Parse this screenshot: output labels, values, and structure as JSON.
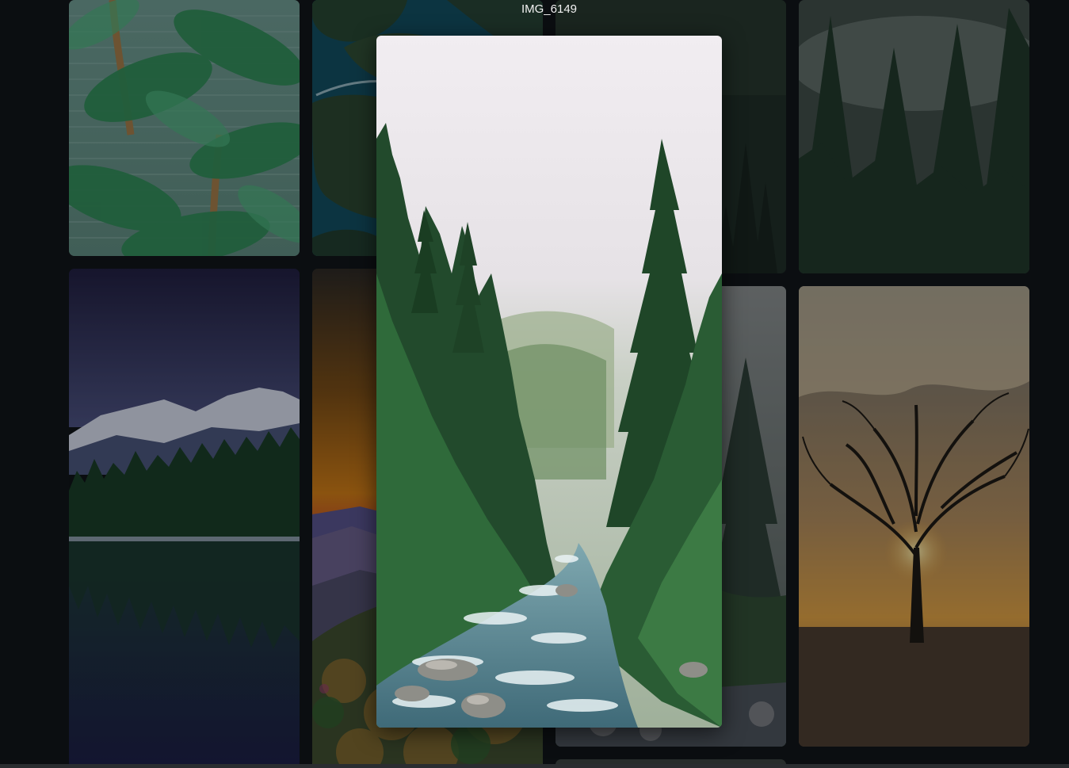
{
  "viewer": {
    "title": "IMG_6149",
    "icon": "forest-river-photo"
  },
  "gallery": {
    "thumbnails": [
      {
        "icon": "palm-leaves-photo"
      },
      {
        "icon": "aerial-island-photo"
      },
      {
        "icon": "dark-forest-photo"
      },
      {
        "icon": "misty-pine-forest-photo"
      },
      {
        "icon": "mountain-lake-photo"
      },
      {
        "icon": "sunset-mountains-photo"
      },
      {
        "icon": "foggy-pine-photo"
      },
      {
        "icon": "sunset-tree-photo"
      }
    ]
  }
}
